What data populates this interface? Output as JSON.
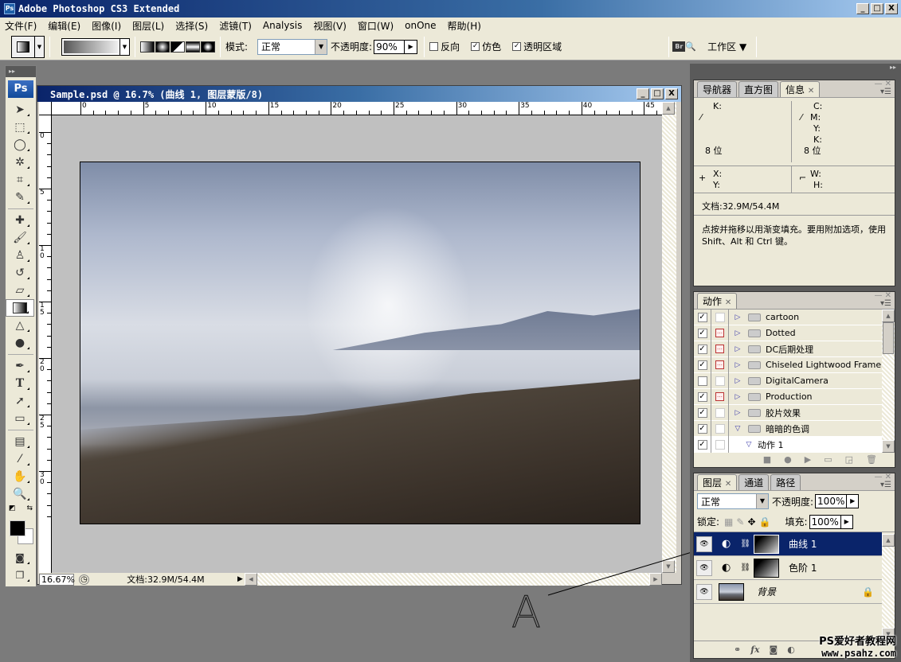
{
  "app": {
    "title": "Adobe Photoshop CS3 Extended",
    "window_buttons": [
      "_",
      "□",
      "X"
    ]
  },
  "menu": [
    "文件(F)",
    "编辑(E)",
    "图像(I)",
    "图层(L)",
    "选择(S)",
    "滤镜(T)",
    "Analysis",
    "视图(V)",
    "窗口(W)",
    "onOne",
    "帮助(H)"
  ],
  "options": {
    "mode_label": "模式:",
    "mode_value": "正常",
    "opacity_label": "不透明度:",
    "opacity_value": "90%",
    "reverse_label": "反向",
    "reverse_checked": false,
    "dither_label": "仿色",
    "dither_checked": true,
    "transparency_label": "透明区域",
    "transparency_checked": true,
    "workspace_label": "工作区 ▼",
    "bridge_label": "Br"
  },
  "toolbox": {
    "logo": "Ps",
    "tools": [
      "move",
      "marquee",
      "lasso",
      "magic-wand",
      "crop",
      "slice",
      "healing",
      "brush",
      "stamp",
      "history-brush",
      "eraser",
      "gradient",
      "blur",
      "dodge",
      "pen",
      "type",
      "path-select",
      "shape",
      "notes",
      "eyedropper",
      "hand",
      "zoom"
    ]
  },
  "document": {
    "title": "Sample.psd @ 16.7% (曲线 1, 图层蒙版/8)",
    "h_ruler": [
      "0",
      "5",
      "10",
      "15",
      "20",
      "25",
      "30",
      "35",
      "40",
      "45"
    ],
    "v_ruler": [
      "0",
      "5",
      "10",
      "15",
      "20",
      "25",
      "30"
    ],
    "zoom": "16.67%",
    "status": "文档:32.9M/54.4M"
  },
  "info_panel": {
    "tabs": [
      "导航器",
      "直方图",
      "信息"
    ],
    "active_tab": "信息",
    "left_labels": [
      "K:"
    ],
    "right_labels": [
      "C:",
      "M:",
      "Y:",
      "K:"
    ],
    "bit_left": "8 位",
    "bit_right": "8 位",
    "xy": [
      "X:",
      "Y:"
    ],
    "wh": [
      "W:",
      "H:"
    ],
    "doc": "文档:32.9M/54.4M",
    "hint": "点按并拖移以用渐变填充。要用附加选项，使用 Shift、Alt 和 Ctrl 键。"
  },
  "actions_panel": {
    "tab": "动作",
    "items": [
      {
        "name": "cartoon",
        "checked": true,
        "dialog": false,
        "expanded": false,
        "indent": 0
      },
      {
        "name": "Dotted",
        "checked": true,
        "dialog": true,
        "expanded": false,
        "indent": 0
      },
      {
        "name": "DC后期处理",
        "checked": true,
        "dialog": true,
        "expanded": false,
        "indent": 0
      },
      {
        "name": "Chiseled Lightwood Frame",
        "checked": true,
        "dialog": true,
        "expanded": false,
        "indent": 0
      },
      {
        "name": "DigitalCamera",
        "checked": false,
        "dialog": false,
        "expanded": false,
        "indent": 0
      },
      {
        "name": "Production",
        "checked": true,
        "dialog": true,
        "expanded": false,
        "indent": 0
      },
      {
        "name": "胶片效果",
        "checked": true,
        "dialog": false,
        "expanded": false,
        "indent": 0
      },
      {
        "name": "暗暗的色调",
        "checked": true,
        "dialog": false,
        "expanded": true,
        "indent": 0
      },
      {
        "name": "动作 1",
        "checked": true,
        "dialog": false,
        "expanded": true,
        "indent": 1
      }
    ]
  },
  "layers_panel": {
    "tabs": [
      "图层",
      "通道",
      "路径"
    ],
    "blend_mode": "正常",
    "opacity_label": "不透明度:",
    "opacity": "100%",
    "lock_label": "锁定:",
    "fill_label": "填充:",
    "fill": "100%",
    "layers": [
      {
        "name": "曲线 1",
        "type": "adjustment",
        "selected": true
      },
      {
        "name": "色阶 1",
        "type": "adjustment",
        "selected": false
      },
      {
        "name": "背景",
        "type": "background",
        "selected": false,
        "locked": true
      }
    ]
  },
  "annotation": {
    "label": "A"
  },
  "watermark": {
    "line1": "PS爱好者教程网",
    "line2": "www.psahz.com"
  }
}
